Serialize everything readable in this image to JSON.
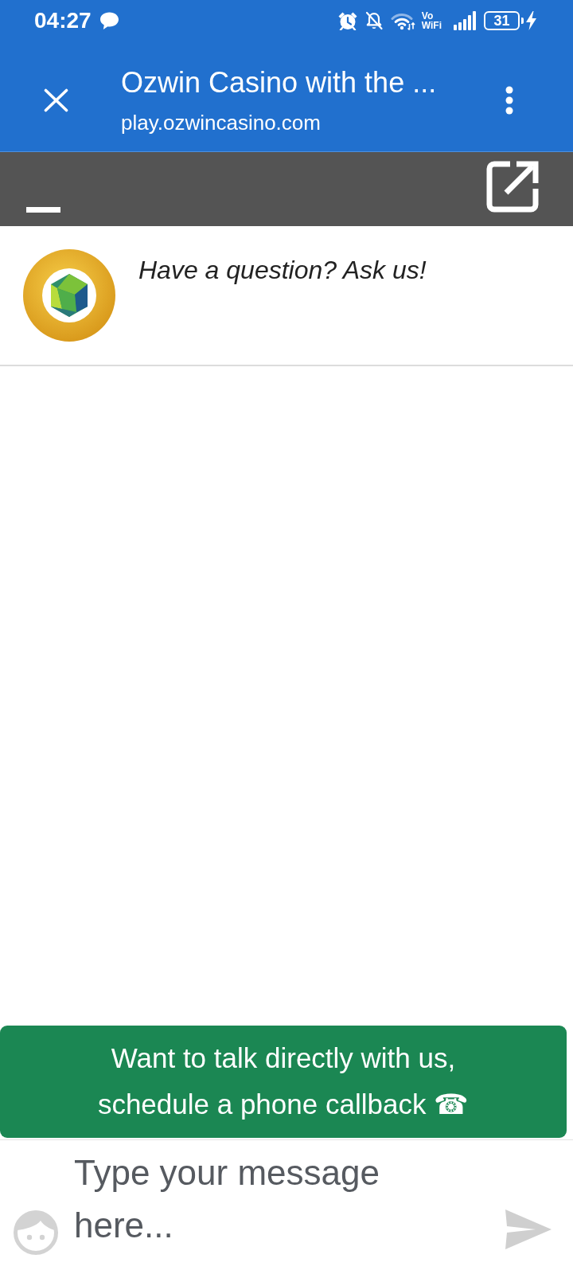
{
  "status_bar": {
    "time": "04:27",
    "wifi_calling": "Vo WiFi",
    "battery": "31"
  },
  "browser_bar": {
    "title": "Ozwin Casino with the ...",
    "url": "play.ozwincasino.com"
  },
  "chat_header": {
    "greeting": "Have a question? Ask us!"
  },
  "callback_banner": {
    "text": "Want to talk directly with us, schedule a phone callback ☎"
  },
  "composer": {
    "placeholder": "Type your message here..."
  }
}
